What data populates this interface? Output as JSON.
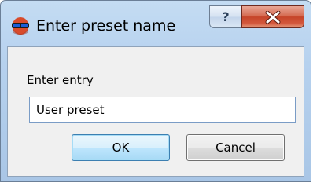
{
  "window": {
    "title": "Enter preset name",
    "help_label": "?",
    "icons": {
      "app": "red-blue-3d-glasses-icon",
      "close": "close-x-icon"
    },
    "colors": {
      "frame": "#b6d1ee",
      "client": "#f0f0f0",
      "close_button": "#c54429",
      "focus_border": "#3c7fb1"
    }
  },
  "dialog": {
    "entry_label": "Enter entry",
    "entry_value": "User preset",
    "ok_label": "OK",
    "cancel_label": "Cancel"
  }
}
